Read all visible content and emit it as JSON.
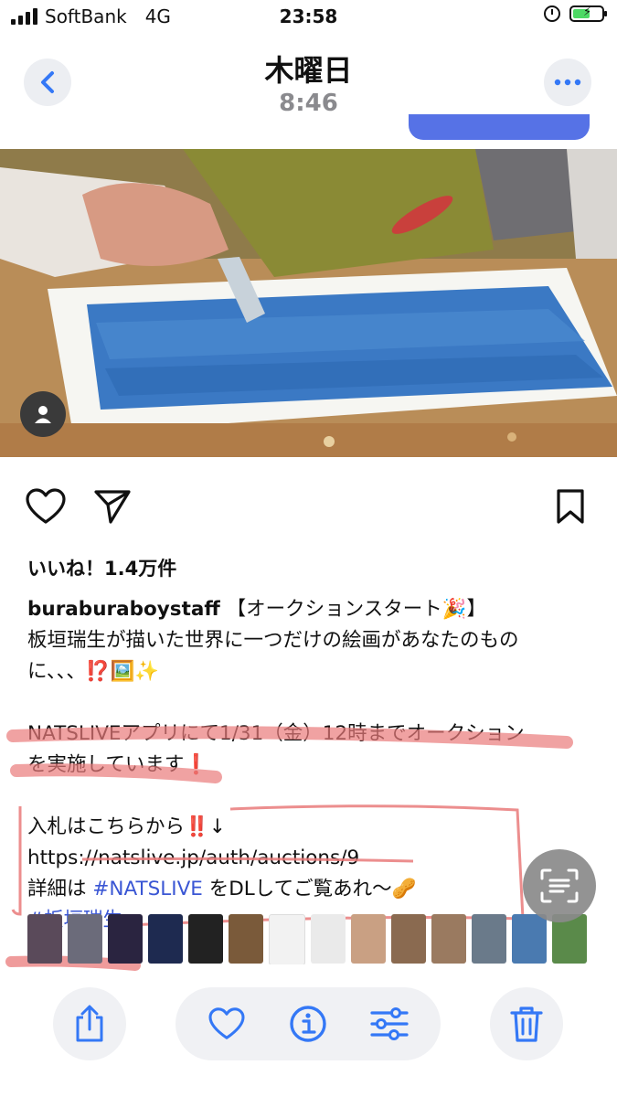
{
  "status_bar": {
    "carrier": "SoftBank",
    "network": "4G",
    "time": "23:58"
  },
  "nav": {
    "title": "木曜日",
    "subtitle": "8:46"
  },
  "post": {
    "likes": "いいね！1.4万件",
    "username": "buraburaboystaff",
    "caption_line1": " 【オークションスタート🎉】",
    "caption_line2": "板垣瑞生が描いた世界に一つだけの絵画があなたのもの",
    "caption_line3": "に、、、⁉️🖼️✨",
    "caption_line4": "NATSLIVEアプリにて1/31（金）12時までオークション",
    "caption_line5": "を実施しています❗️",
    "caption_line6": "入札はこちらから‼️↓",
    "url": "https://natslive.jp/auth/auctions/9",
    "caption_line8_prefix": "詳細は ",
    "hashtag_natslive": "#NATSLIVE",
    "caption_line8_suffix": " をDLしてご覧あれ〜🥜",
    "hashtag_name": "#板垣瑞生"
  },
  "colors": {
    "accent": "#3478f6",
    "hashtag": "#3a56d4",
    "underline": "#e97a7a",
    "paint_blue": "#3b79c4"
  },
  "icons": [
    "back-chevron-icon",
    "more-icon",
    "person-icon",
    "heart-icon",
    "send-icon",
    "bookmark-icon",
    "text-scan-icon",
    "share-icon",
    "favorite-icon",
    "info-icon",
    "adjust-icon",
    "trash-icon"
  ]
}
